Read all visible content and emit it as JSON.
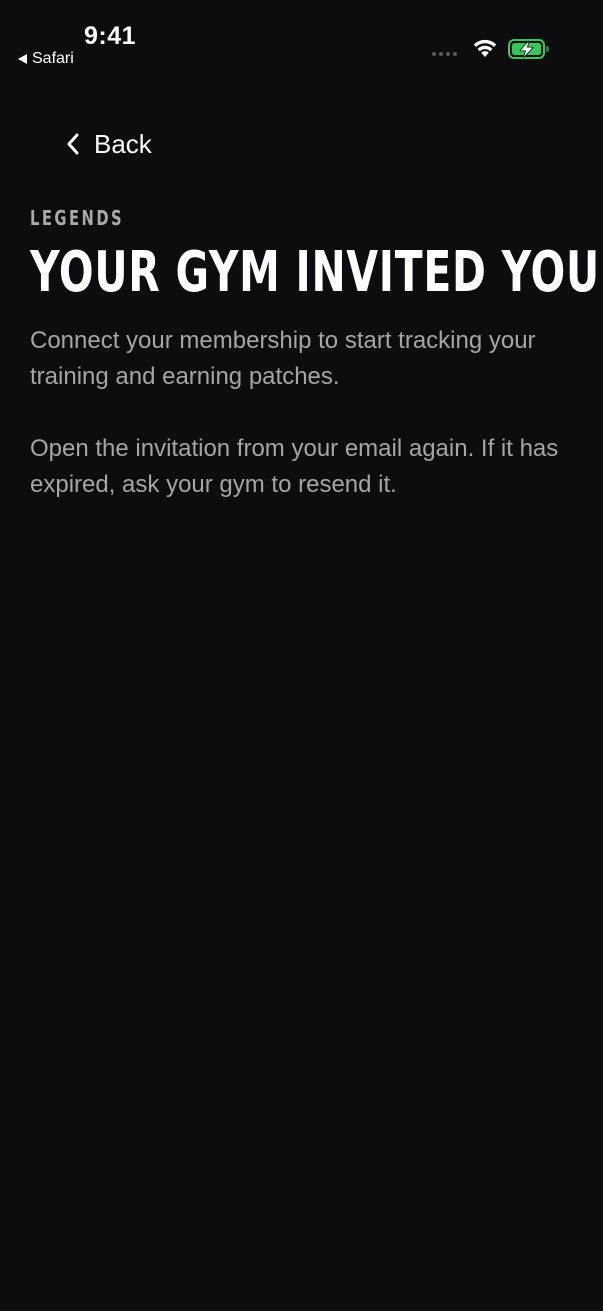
{
  "status_bar": {
    "time": "9:41",
    "back_app": "Safari"
  },
  "nav": {
    "back_label": "Back"
  },
  "content": {
    "eyebrow": "LEGENDS",
    "title": "YOUR GYM INVITED YOU",
    "paragraph_1": "Connect your membership to start tracking your training and earning patches.",
    "paragraph_2": "Open the invitation from your email again. If it has expired, ask your gym to resend it."
  },
  "colors": {
    "background": "#0d0d0f",
    "primary_text": "#ffffff",
    "secondary_text": "#a4a4a9",
    "battery_charging": "#34c759"
  },
  "icons": {
    "back": "chevron-left-icon",
    "wifi": "wifi-icon",
    "battery": "battery-charging-icon",
    "signal": "cellular-signal-icon"
  }
}
